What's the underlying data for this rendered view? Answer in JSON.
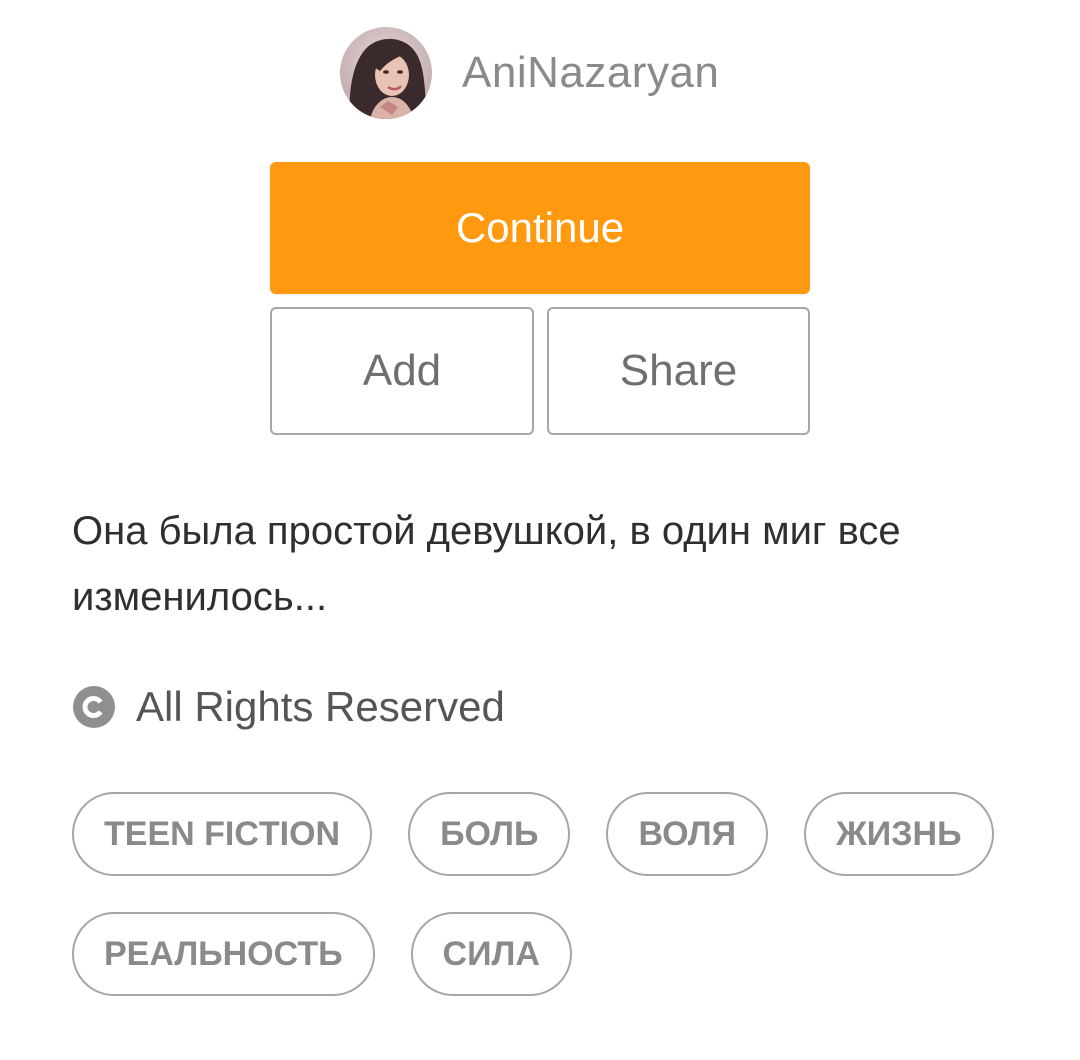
{
  "author": {
    "name": "AniNazaryan",
    "avatar_icon": "user-avatar"
  },
  "actions": {
    "continue_label": "Continue",
    "add_label": "Add",
    "share_label": "Share",
    "accent_color": "#ff9a10"
  },
  "description": "Она была простой девушкой, в один миг все изменилось...",
  "license": {
    "icon": "copyright-icon",
    "text": "All Rights Reserved"
  },
  "tags": [
    [
      "TEEN FICTION",
      "БОЛЬ",
      "ВОЛЯ",
      "ЖИЗНЬ"
    ],
    [
      "РЕАЛЬНОСТЬ",
      "СИЛА"
    ]
  ]
}
